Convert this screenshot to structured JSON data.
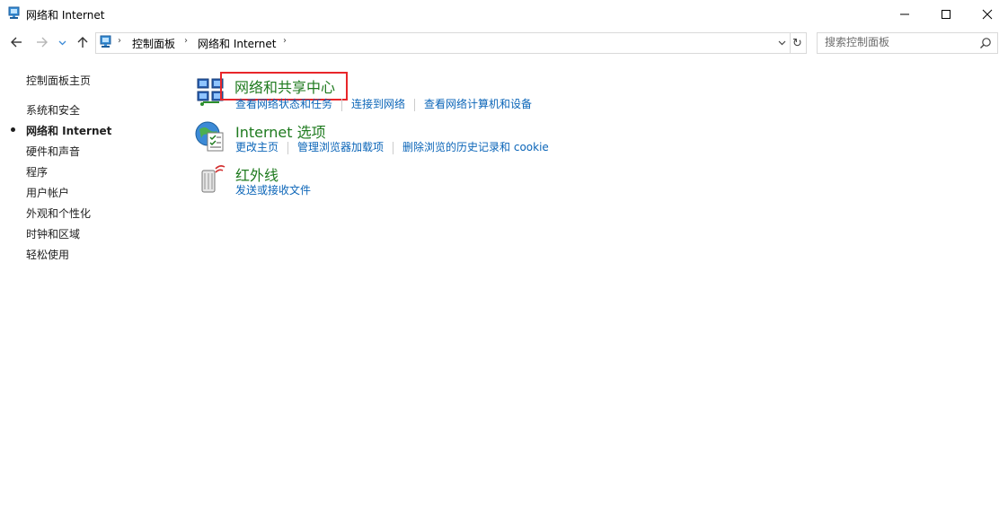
{
  "window": {
    "title": "网络和 Internet",
    "controls": [
      "minimize",
      "maximize",
      "close"
    ]
  },
  "navbar": {
    "breadcrumbs": [
      "控制面板",
      "网络和 Internet"
    ],
    "search_placeholder": "搜索控制面板"
  },
  "sidebar": {
    "items": [
      {
        "label": "控制面板主页",
        "selected": false
      },
      {
        "label": "系统和安全",
        "selected": false
      },
      {
        "label": "网络和 Internet",
        "selected": true
      },
      {
        "label": "硬件和声音",
        "selected": false
      },
      {
        "label": "程序",
        "selected": false
      },
      {
        "label": "用户帐户",
        "selected": false
      },
      {
        "label": "外观和个性化",
        "selected": false
      },
      {
        "label": "时钟和区域",
        "selected": false
      },
      {
        "label": "轻松使用",
        "selected": false
      }
    ]
  },
  "categories": [
    {
      "title": "网络和共享中心",
      "icon": "network-sharing-center-icon",
      "highlighted": true,
      "links": [
        "查看网络状态和任务",
        "连接到网络",
        "查看网络计算机和设备"
      ]
    },
    {
      "title": "Internet 选项",
      "icon": "internet-options-icon",
      "highlighted": false,
      "links": [
        "更改主页",
        "管理浏览器加载项",
        "删除浏览的历史记录和 cookie"
      ]
    },
    {
      "title": "红外线",
      "icon": "infrared-icon",
      "highlighted": false,
      "links": [
        "发送或接收文件"
      ]
    }
  ],
  "colors": {
    "category_title": "#1e7a1e",
    "link": "#0b65b8",
    "highlight_border": "#e8262a"
  }
}
